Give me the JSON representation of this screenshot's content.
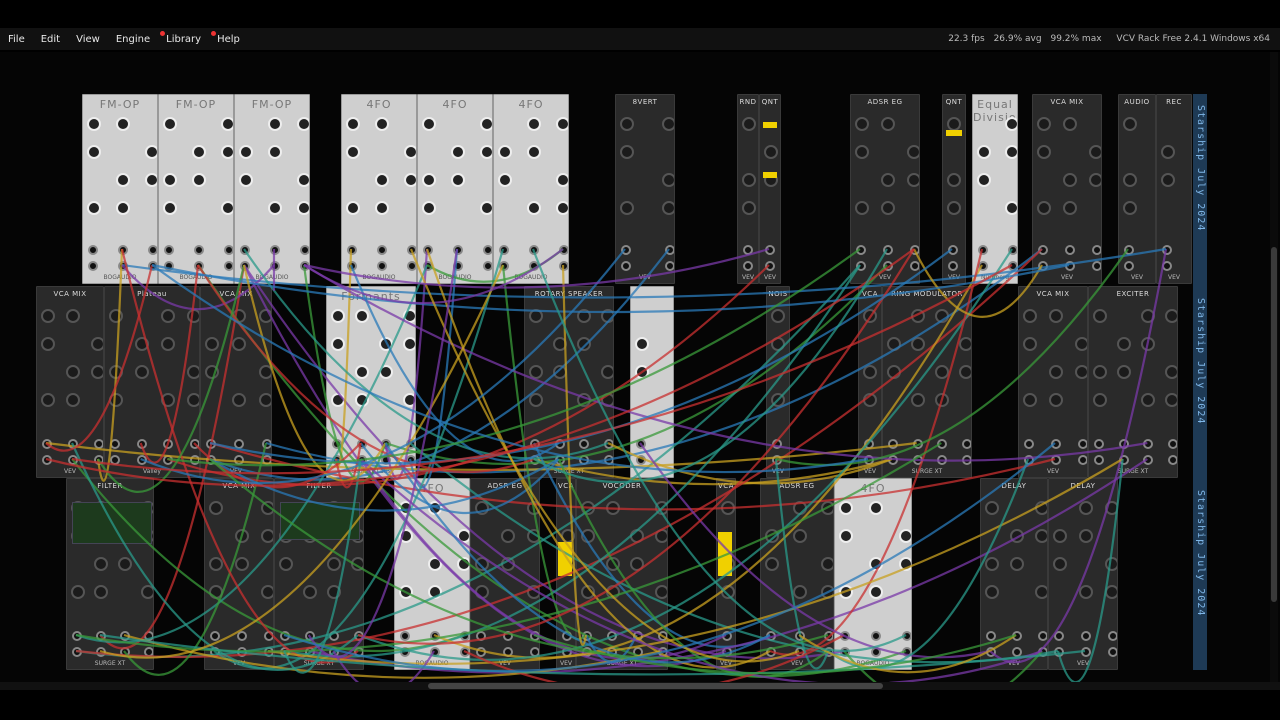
{
  "menu": [
    "File",
    "Edit",
    "View",
    "Engine",
    "Library",
    "Help"
  ],
  "status": {
    "fps": "22.3 fps",
    "avg": "26.9% avg",
    "max": "99.2% max",
    "app": "VCV Rack Free 2.4.1 Windows x64"
  },
  "notes_text": "Starship July 2024",
  "row1": [
    {
      "title": "FM-OP",
      "brand": "BOGAUDIO",
      "theme": "light"
    },
    {
      "title": "FM-OP",
      "brand": "BOGAUDIO",
      "theme": "light"
    },
    {
      "title": "FM-OP",
      "brand": "BOGAUDIO",
      "theme": "light"
    },
    {
      "title": "4FO",
      "brand": "BOGAUDIO",
      "theme": "light"
    },
    {
      "title": "4FO",
      "brand": "BOGAUDIO",
      "theme": "light"
    },
    {
      "title": "4FO",
      "brand": "BOGAUDIO",
      "theme": "light"
    },
    {
      "title": "8VERT",
      "brand": "VEV",
      "theme": "dark"
    },
    {
      "title": "RND",
      "brand": "VEV",
      "theme": "dark"
    },
    {
      "title": "QNT",
      "brand": "VEV",
      "theme": "dark"
    },
    {
      "title": "ADSR EG",
      "brand": "VEV",
      "theme": "dark"
    },
    {
      "title": "QNT",
      "brand": "VEV",
      "theme": "dark"
    },
    {
      "title": "Equal Division",
      "brand": "Nürnberg",
      "theme": "light"
    },
    {
      "title": "VCA MIX",
      "brand": "VEV",
      "theme": "dark"
    },
    {
      "title": "AUDIO",
      "brand": "VEV",
      "theme": "dark"
    },
    {
      "title": "REC",
      "brand": "VEV",
      "theme": "dark"
    }
  ],
  "row2": [
    {
      "title": "VCA MIX",
      "brand": "VEV",
      "theme": "dark"
    },
    {
      "title": "Plateau",
      "brand": "Valley",
      "theme": "dark"
    },
    {
      "title": "VCA MIX",
      "brand": "VEV",
      "theme": "dark"
    },
    {
      "title": "Formants",
      "brand": "Squinky Labs",
      "theme": "light"
    },
    {
      "title": "ROTARY SPEAKER",
      "brand": "SURGE XT",
      "theme": "dark"
    },
    {
      "title": "",
      "brand": "",
      "theme": "light"
    },
    {
      "title": "NOIS",
      "brand": "VEV",
      "theme": "dark"
    },
    {
      "title": "VCA",
      "brand": "VEV",
      "theme": "dark"
    },
    {
      "title": "RING MODULATOR",
      "brand": "SURGE XT",
      "theme": "dark"
    },
    {
      "title": "VCA MIX",
      "brand": "VEV",
      "theme": "dark"
    },
    {
      "title": "EXCITER",
      "brand": "SURGE XT",
      "theme": "dark"
    }
  ],
  "row3": [
    {
      "title": "FILTER",
      "brand": "SURGE XT",
      "theme": "dark"
    },
    {
      "title": "VCA MIX",
      "brand": "VEV",
      "theme": "dark"
    },
    {
      "title": "FILTER",
      "brand": "SURGE XT",
      "theme": "dark"
    },
    {
      "title": "4FO",
      "brand": "BOGAUDIO",
      "theme": "light"
    },
    {
      "title": "ADSR EG",
      "brand": "VEV",
      "theme": "dark"
    },
    {
      "title": "VCA",
      "brand": "VEV",
      "theme": "dark"
    },
    {
      "title": "VOCODER",
      "brand": "SURGE XT",
      "theme": "dark"
    },
    {
      "title": "VCA",
      "brand": "VEV",
      "theme": "dark"
    },
    {
      "title": "ADSR EG",
      "brand": "VEV",
      "theme": "dark"
    },
    {
      "title": "4FO",
      "brand": "BOGAUDIO",
      "theme": "light"
    },
    {
      "title": "DELAY",
      "brand": "VEV",
      "theme": "dark"
    },
    {
      "title": "DELAY",
      "brand": "VEV",
      "theme": "dark"
    }
  ],
  "cable_colors": [
    "#c8a020",
    "#3a9a3a",
    "#7a3aa8",
    "#2a7ab8",
    "#c83030",
    "#2a9a8a"
  ]
}
